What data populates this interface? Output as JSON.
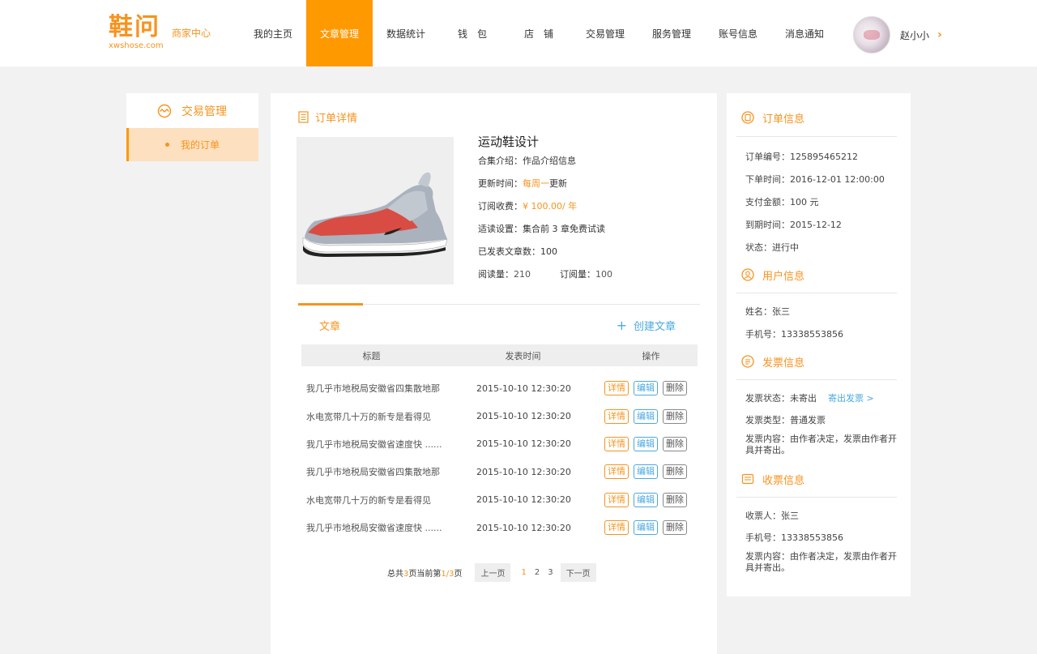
{
  "header": {
    "logo_main": "鞋问",
    "logo_sub": "商家中心",
    "logo_url": "xwshose.com",
    "nav": [
      "我的主页",
      "文章管理",
      "数据统计",
      "钱　包",
      "店　铺",
      "交易管理",
      "服务管理",
      "账号信息",
      "消息通知"
    ],
    "active_nav": "文章管理",
    "user_name": "赵小小",
    "user_arrow": "›"
  },
  "sidebar": {
    "title": "交易管理",
    "item": "我的订单"
  },
  "order": {
    "section_title": "订单详情",
    "product_name": "运动鞋设计",
    "intro_label": "合集介绍：",
    "intro_value": "作品介绍信息",
    "update_label": "更新时间：",
    "update_value_orange": "每周一",
    "update_value_rest": "更新",
    "fee_label": "订阅收费：",
    "fee_value": "¥ 100.00/ 年",
    "trial_label": "适读设置：",
    "trial_value": "集合前 3 章免费试读",
    "published_label": "已发表文章数：",
    "published_value": "100",
    "reads_label": "阅读量：",
    "reads_value": "210",
    "subs_label": "订阅量：",
    "subs_value": "100"
  },
  "articles": {
    "tab": "文章",
    "create": "创建文章",
    "columns": [
      "标题",
      "发表时间",
      "操作"
    ],
    "rows": [
      {
        "title": "我几乎市地税局安徽省四集散地那",
        "time": "2015-10-10  12:30:20"
      },
      {
        "title": "水电宽带几十万的新专是看得见",
        "time": "2015-10-10  12:30:20"
      },
      {
        "title": "我几乎市地税局安徽省速度快 ......",
        "time": "2015-10-10  12:30:20"
      },
      {
        "title": "我几乎市地税局安徽省四集散地那",
        "time": "2015-10-10  12:30:20"
      },
      {
        "title": "水电宽带几十万的新专是看得见",
        "time": "2015-10-10  12:30:20"
      },
      {
        "title": "我几乎市地税局安徽省速度快 ......",
        "time": "2015-10-10  12:30:20"
      }
    ],
    "actions": {
      "detail": "详情",
      "edit": "编辑",
      "delete": "删除"
    }
  },
  "pager": {
    "total_prefix": "总共",
    "total_pages": "3",
    "total_mid": "页当前第",
    "current": "1/3",
    "total_suffix": "页",
    "prev": "上一页",
    "pages": [
      "1",
      "2",
      "3"
    ],
    "next": "下一页"
  },
  "order_info": {
    "title": "订单信息",
    "number": "订单编号：125895465212",
    "order_time": "下单时间：2016-12-01  12:00:00",
    "amount": "支付金额：100 元",
    "expire": "到期时间：2015-12-12",
    "status": "状态：进行中"
  },
  "user_info": {
    "title": "用户信息",
    "name": "姓名：张三",
    "phone": "手机号：13338553856"
  },
  "invoice_info": {
    "title": "发票信息",
    "status": "发票状态：未寄出",
    "send_link": "寄出发票 >",
    "type": "发票类型：普通发票",
    "content": "发票内容：由作者决定，发票由作者开具并寄出。"
  },
  "receiver_info": {
    "title": "收票信息",
    "name": "收票人：张三",
    "phone": "手机号：13338553856",
    "content": "发票内容：由作者决定，发票由作者开具并寄出。"
  },
  "colors": {
    "accent": "#ff9900",
    "link": "#4aa9e0",
    "active_side": "#fce0bf"
  }
}
